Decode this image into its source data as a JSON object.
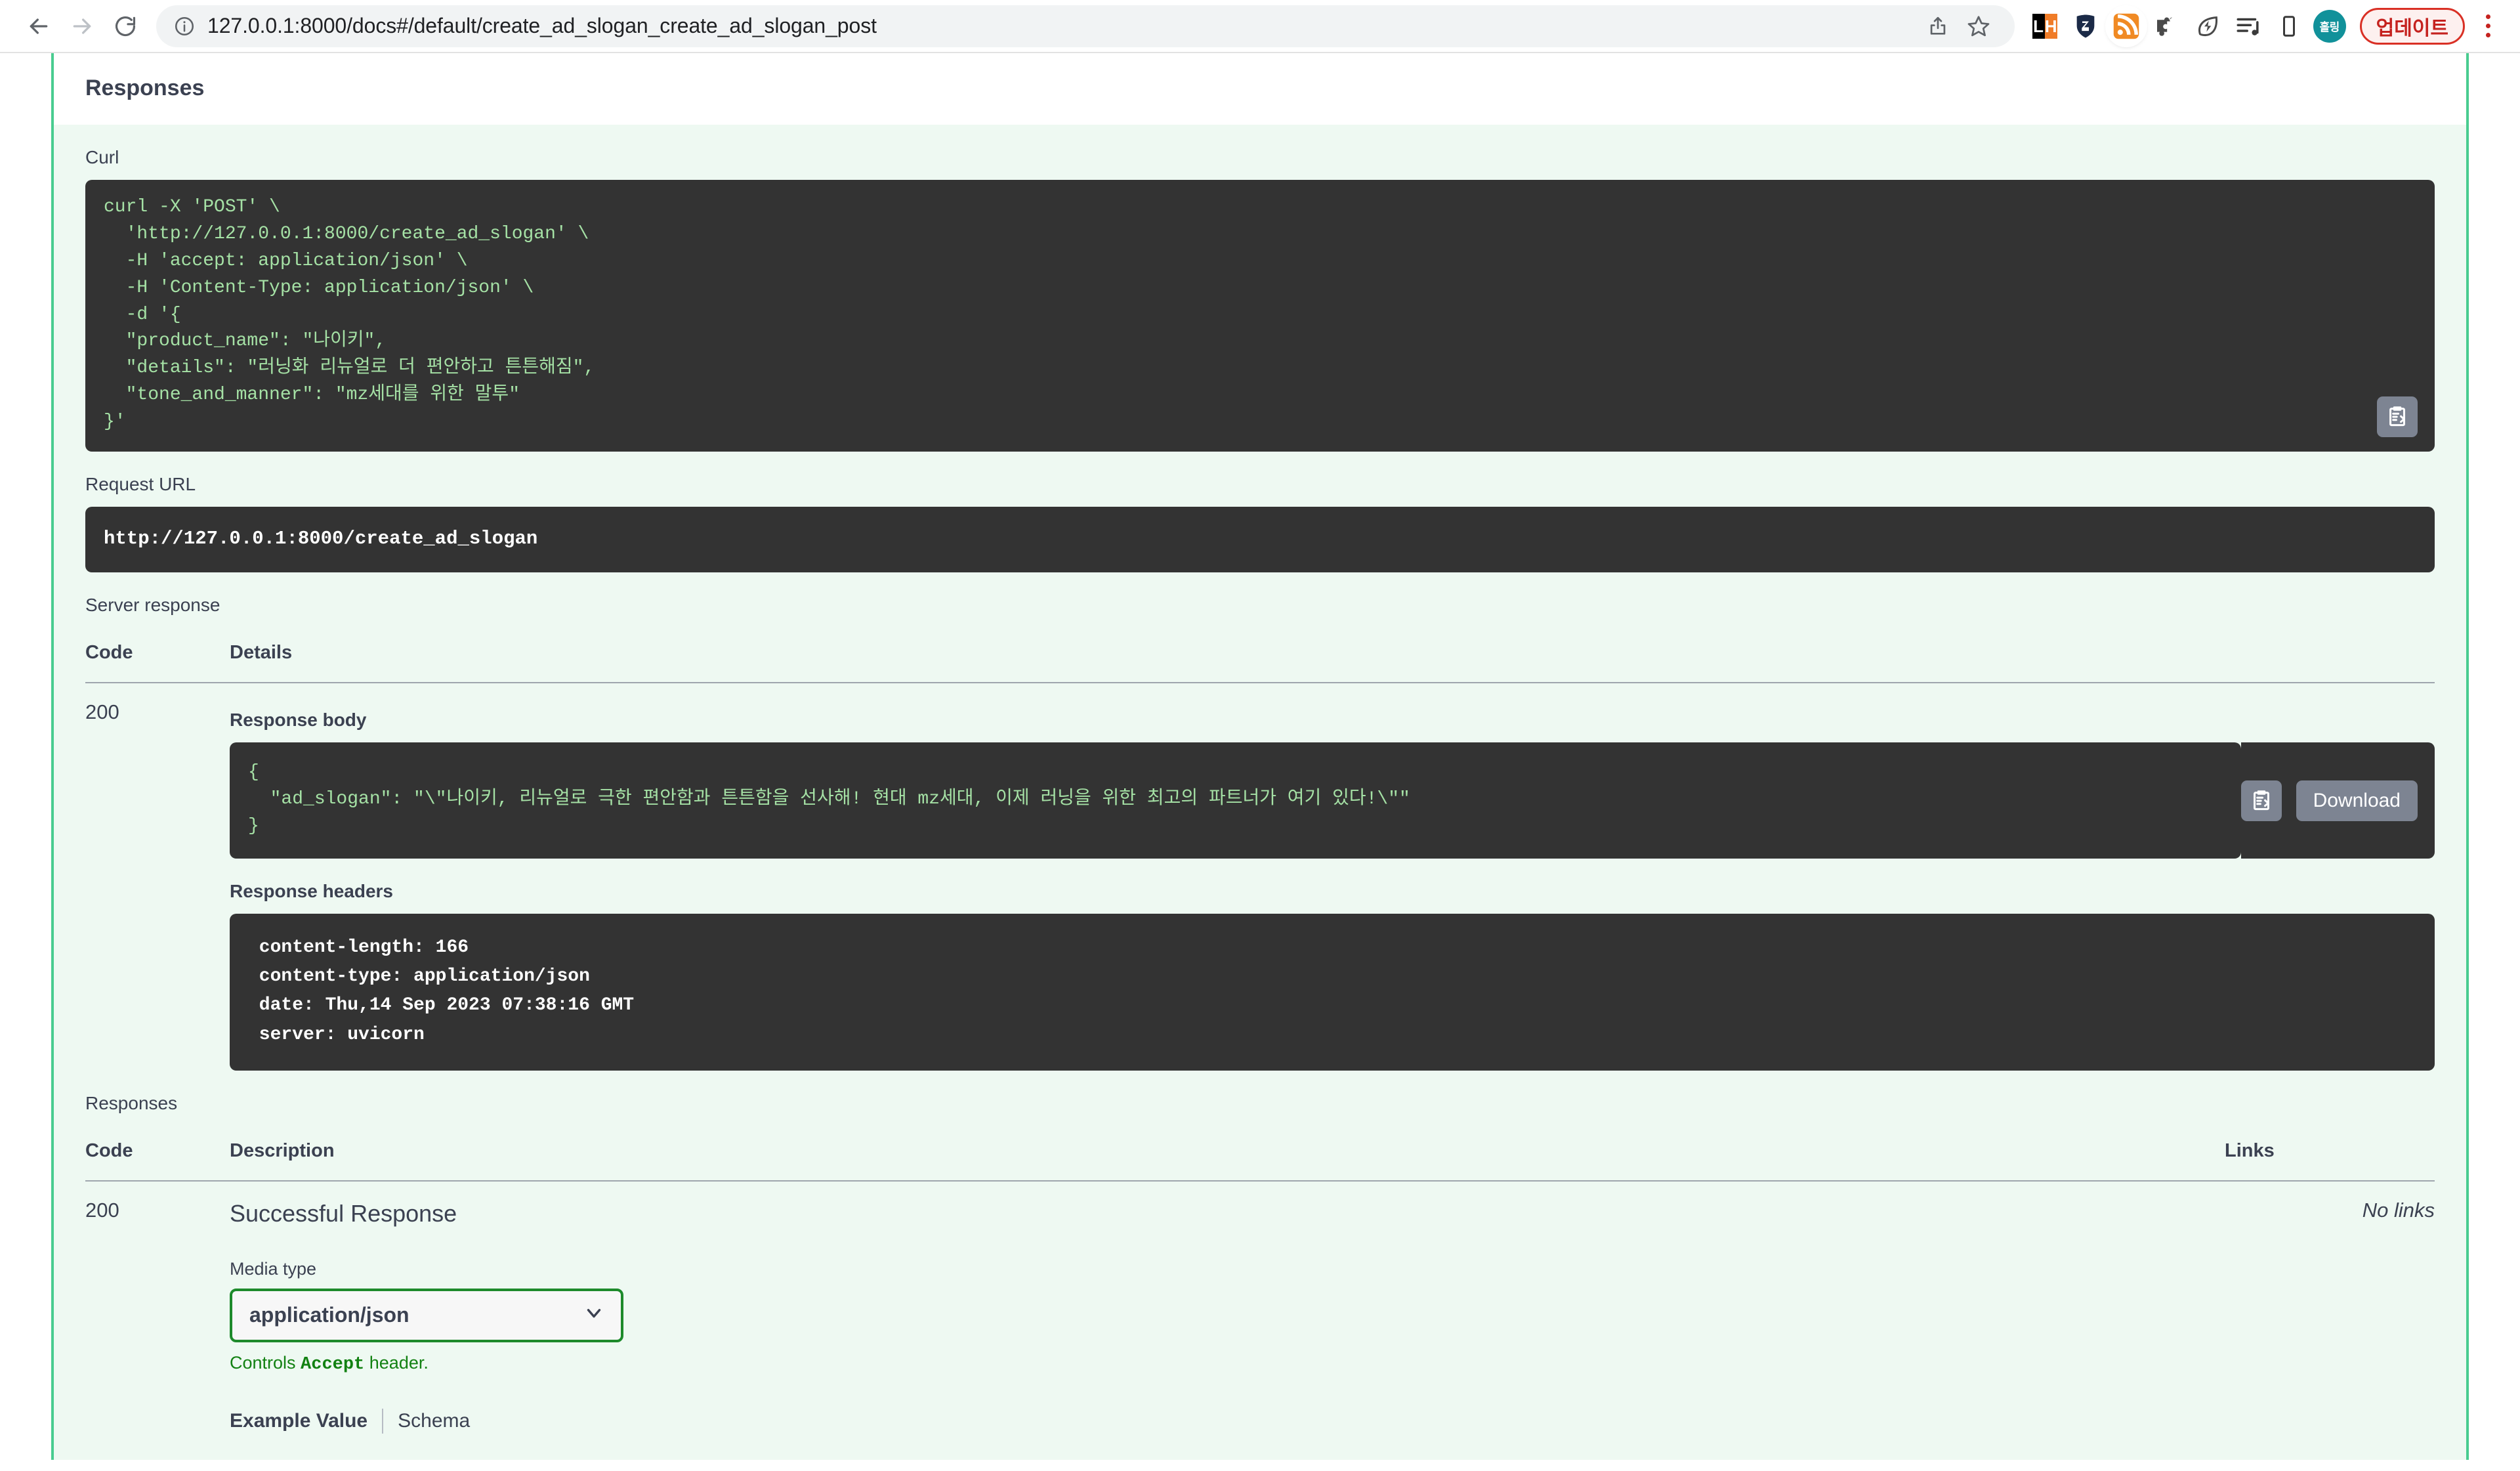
{
  "browser": {
    "url": "127.0.0.1:8000/docs#/default/create_ad_slogan_create_ad_slogan_post",
    "back_label": "Back",
    "forward_label": "Forward",
    "reload_label": "Reload",
    "site_info_label": "View site information",
    "share_label": "Share",
    "bookmark_label": "Bookmark this tab",
    "extensions": {
      "lighthouse_left": "L",
      "lighthouse_right": "H",
      "holling_badge": "홀링",
      "update_button": "업데이트"
    }
  },
  "page": {
    "section_title": "Responses",
    "curl": {
      "label": "Curl",
      "code": "curl -X 'POST' \\\n  'http://127.0.0.1:8000/create_ad_slogan' \\\n  -H 'accept: application/json' \\\n  -H 'Content-Type: application/json' \\\n  -d '{\n  \"product_name\": \"나이키\",\n  \"details\": \"러닝화 리뉴얼로 더 편안하고 튼튼해짐\",\n  \"tone_and_manner\": \"mz세대를 위한 말투\"\n}'"
    },
    "request_url": {
      "label": "Request URL",
      "value": "http://127.0.0.1:8000/create_ad_slogan"
    },
    "server_response": {
      "label": "Server response",
      "columns": {
        "code": "Code",
        "details": "Details"
      },
      "code": "200",
      "response_body": {
        "label": "Response body",
        "code": "{\n  \"ad_slogan\": \"\\\"나이키, 리뉴얼로 극한 편안함과 튼튼함을 선사해! 현대 mz세대, 이제 러닝을 위한 최고의 파트너가 여기 있다!\\\"\"\n}",
        "download_label": "Download"
      },
      "response_headers": {
        "label": "Response headers",
        "code": " content-length: 166 \n content-type: application/json \n date: Thu,14 Sep 2023 07:38:16 GMT \n server: uvicorn "
      }
    },
    "responses": {
      "label": "Responses",
      "columns": {
        "code": "Code",
        "description": "Description",
        "links": "Links"
      },
      "rows": [
        {
          "code": "200",
          "description": "Successful Response",
          "links": "No links",
          "media_type_label": "Media type",
          "media_type_value": "application/json",
          "accept_note_prefix": "Controls ",
          "accept_note_mono": "Accept",
          "accept_note_suffix": " header.",
          "example_tab": "Example Value",
          "schema_tab": "Schema"
        }
      ]
    }
  },
  "colors": {
    "accent_green": "#49cc90",
    "panel_bg": "#eef9f2",
    "code_bg": "#333333",
    "code_text": "#a5e1a5",
    "select_border": "#1d8a2b",
    "note_green": "#128112",
    "update_red": "#d93025"
  }
}
